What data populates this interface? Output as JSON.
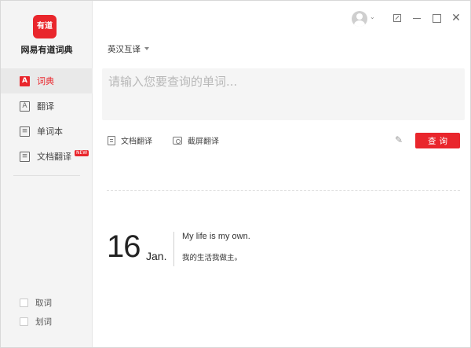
{
  "app": {
    "logo_text": "有道",
    "brand_name": "网易有道词典"
  },
  "sidebar": {
    "items": [
      {
        "label": "词典",
        "icon": "dictionary-icon",
        "active": true
      },
      {
        "label": "翻译",
        "icon": "translate-icon",
        "active": false
      },
      {
        "label": "单词本",
        "icon": "wordbook-icon",
        "active": false
      },
      {
        "label": "文档翻译",
        "icon": "document-translate-icon",
        "active": false,
        "badge": "NEW"
      }
    ],
    "options": [
      {
        "label": "取词",
        "checked": false
      },
      {
        "label": "划词",
        "checked": false
      }
    ]
  },
  "titlebar": {
    "icons": [
      "avatar-icon",
      "mini-mode-icon",
      "minimize-icon",
      "maximize-icon",
      "close-icon"
    ],
    "close_glyph": "✕"
  },
  "main": {
    "language_select": "英汉互译",
    "search": {
      "placeholder": "请输入您要查询的单词...",
      "value": ""
    },
    "tools": [
      {
        "label": "文档翻译",
        "icon": "document-icon"
      },
      {
        "label": "截屏翻译",
        "icon": "screenshot-icon"
      }
    ],
    "query_button": "查询",
    "pen_glyph": "✎"
  },
  "daily_sentence": {
    "day": "16",
    "month": "Jan.",
    "english": "My life is my own.",
    "chinese": "我的生活我做主。"
  },
  "colors": {
    "accent": "#e9262c",
    "sidebar_bg": "#f4f4f4",
    "search_bg": "#f5f5f5"
  }
}
